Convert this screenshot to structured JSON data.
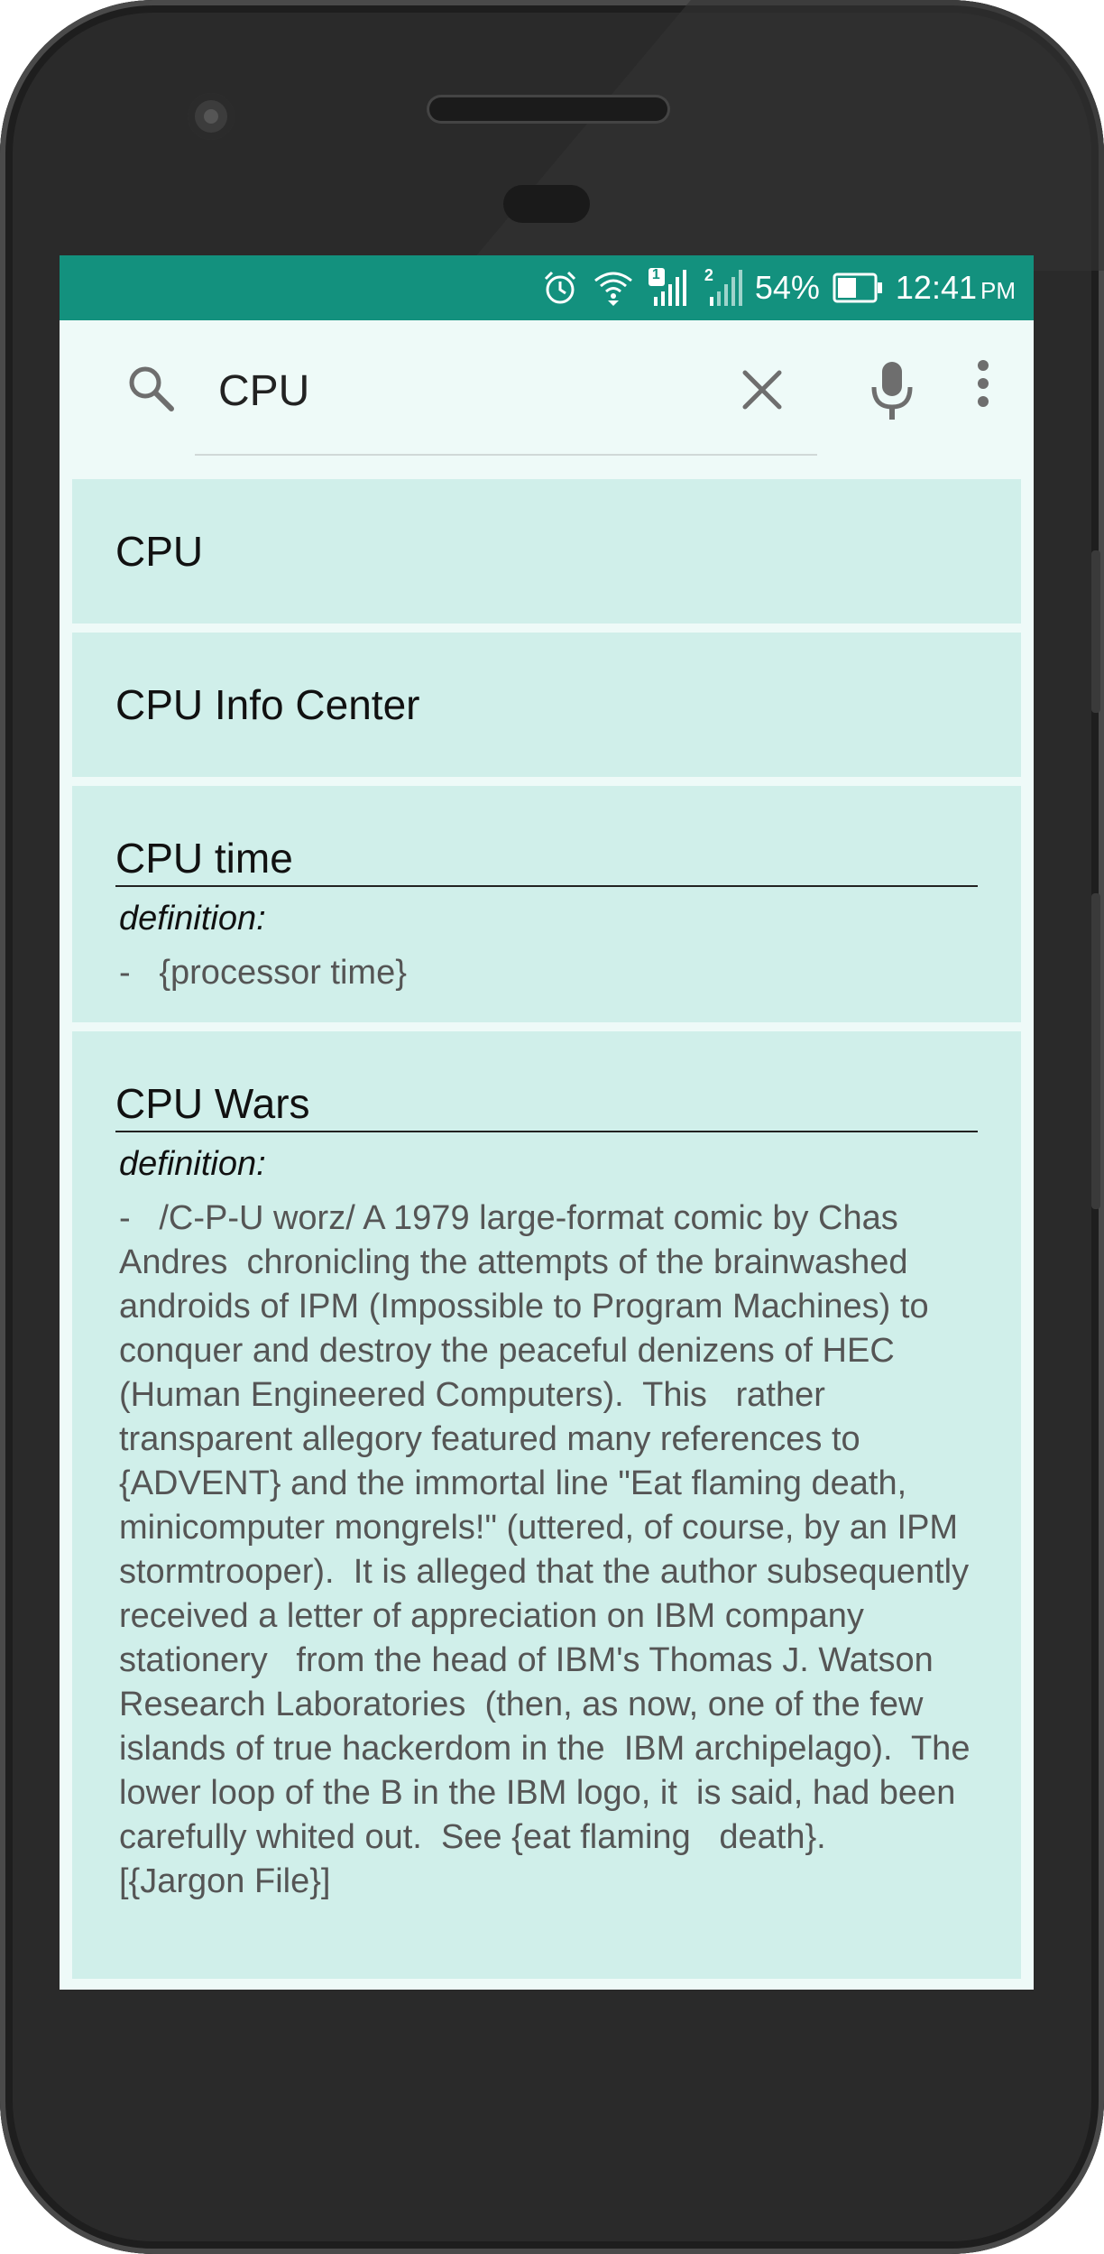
{
  "status_bar": {
    "sim1_badge": "1",
    "sim2_badge": "2",
    "battery": "54%",
    "time": "12:41",
    "ampm": "PM",
    "icons": [
      "alarm-icon",
      "wifi-icon",
      "signal-sim1-icon",
      "signal-sim2-icon",
      "battery-icon"
    ]
  },
  "search": {
    "value": "CPU",
    "icons": [
      "search-icon",
      "clear-icon",
      "mic-icon",
      "more-vert-icon"
    ]
  },
  "results": [
    {
      "title": "CPU"
    },
    {
      "title": "CPU Info Center"
    },
    {
      "title": "CPU time",
      "definition_label": "definition:",
      "definition": "-   {processor time}"
    },
    {
      "title": "CPU Wars",
      "definition_label": "definition:",
      "definition": "-   /C-P-U worz/ A 1979 large-format comic by Chas Andres  chronicling the attempts of the brainwashed androids of IPM (Impossible to Program Machines) to conquer and destroy the peaceful denizens of HEC (Human Engineered Computers).  This   rather transparent allegory featured many references to {ADVENT} and the immortal line \"Eat flaming death, minicomputer mongrels!\" (uttered, of course, by an IPM stormtrooper).  It is alleged that the author subsequently received a letter of appreciation on IBM company stationery   from the head of IBM's Thomas J. Watson Research Laboratories  (then, as now, one of the few islands of true hackerdom in the  IBM archipelago).  The lower loop of the B in the IBM logo, it  is said, had been carefully whited out.  See {eat flaming   death}.   [{Jargon File}]"
    }
  ],
  "colors": {
    "status_bar": "#13917e",
    "background": "#eefaf8",
    "card": "#d0efea"
  }
}
